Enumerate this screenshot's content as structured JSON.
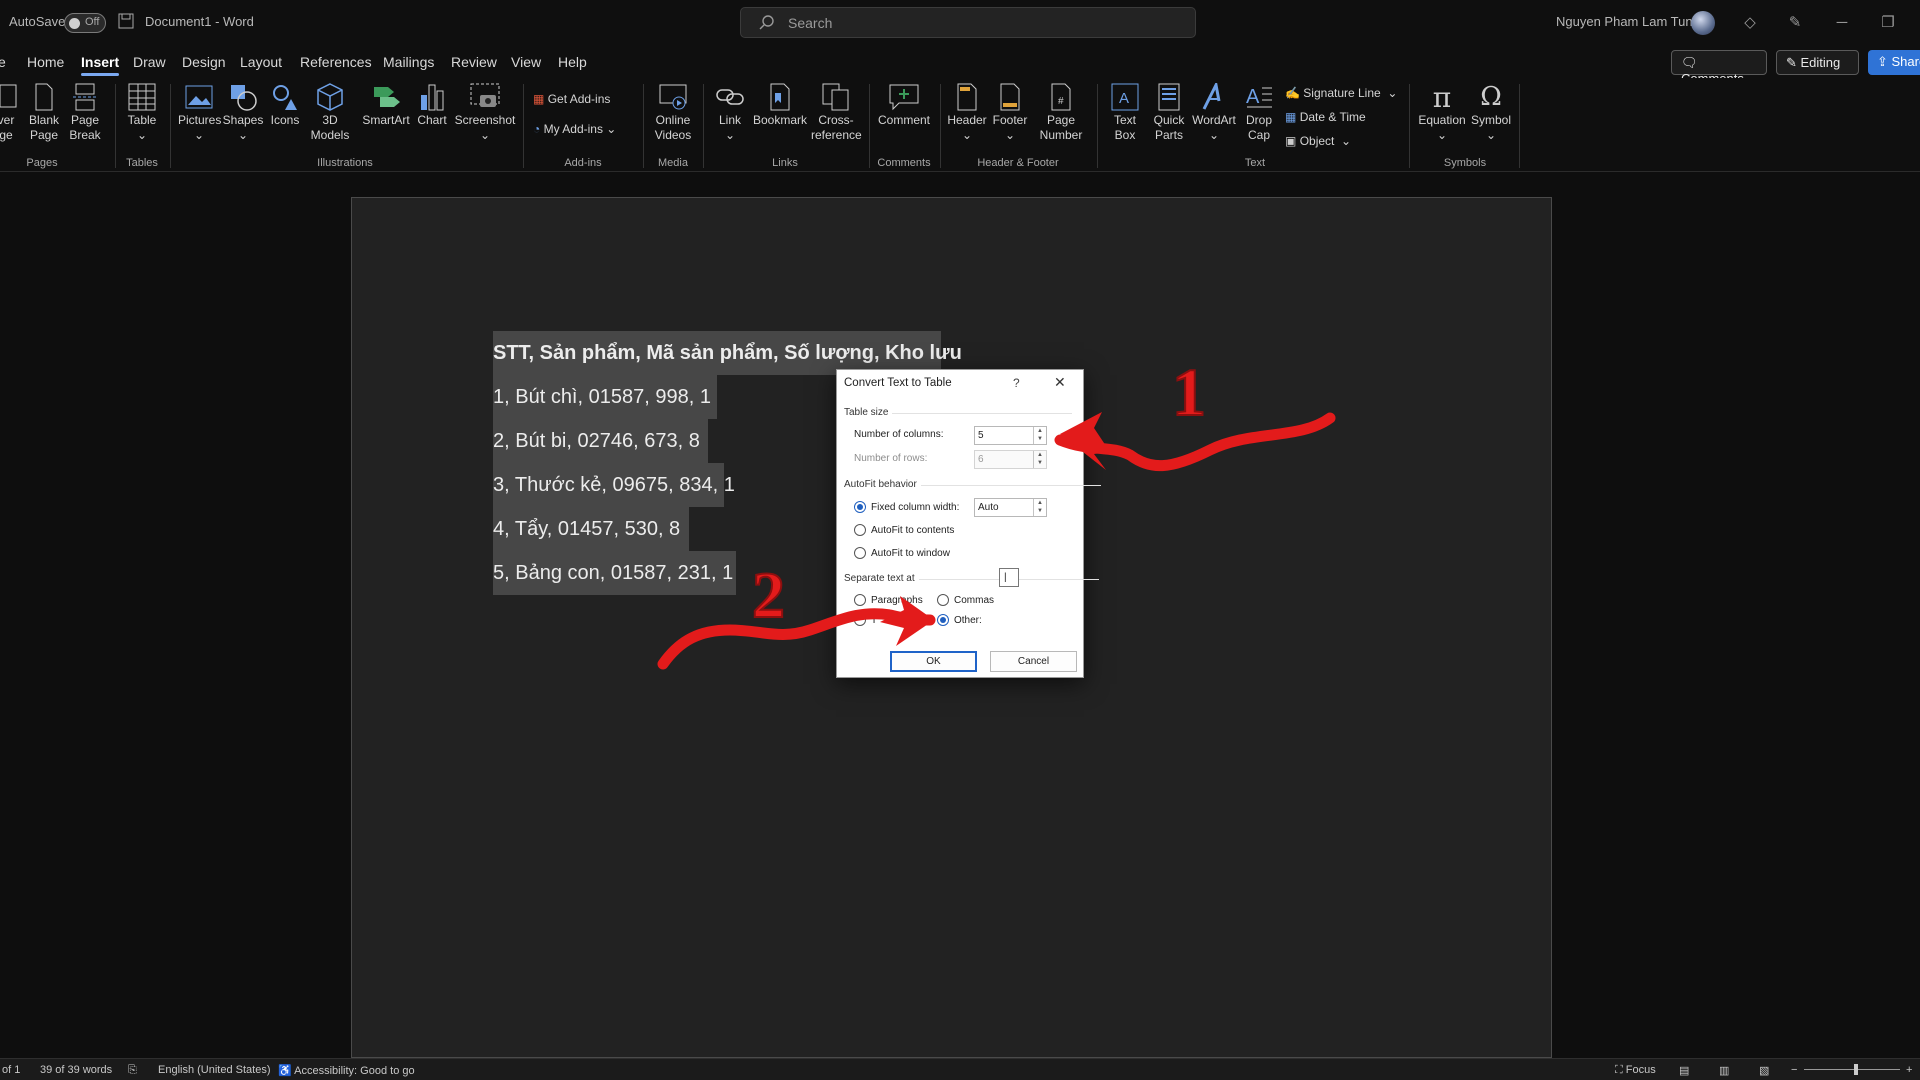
{
  "titlebar": {
    "autosave": "AutoSave",
    "toggle": "Off",
    "doc_title": "Document1 - Word",
    "search_placeholder": "Search",
    "user": "Nguyen Pham Lam Tung"
  },
  "menu": {
    "tabs": [
      "e",
      "Home",
      "Insert",
      "Draw",
      "Design",
      "Layout",
      "References",
      "Mailings",
      "Review",
      "View",
      "Help"
    ],
    "active": "Insert",
    "comments": "Comments",
    "editing": "Editing",
    "share": "Share"
  },
  "ribbon": {
    "pages": {
      "cover": [
        "ver",
        "ge"
      ],
      "blank": [
        "Blank",
        "Page"
      ],
      "break": [
        "Page",
        "Break"
      ],
      "group": "Pages"
    },
    "tables": {
      "table": "Table",
      "group": "Tables"
    },
    "illustrations": {
      "pictures": "Pictures",
      "shapes": "Shapes",
      "icons": "Icons",
      "models": [
        "3D",
        "Models"
      ],
      "smartart": "SmartArt",
      "chart": "Chart",
      "screenshot": "Screenshot",
      "group": "Illustrations"
    },
    "addins": {
      "get": "Get Add-ins",
      "my": "My Add-ins",
      "group": "Add-ins"
    },
    "media": {
      "online": [
        "Online",
        "Videos"
      ],
      "group": "Media"
    },
    "links": {
      "link": "Link",
      "bookmark": "Bookmark",
      "cross": [
        "Cross-",
        "reference"
      ],
      "group": "Links"
    },
    "comments": {
      "comment": "Comment",
      "group": "Comments"
    },
    "headerfooter": {
      "header": "Header",
      "footer": "Footer",
      "pagenum": [
        "Page",
        "Number"
      ],
      "group": "Header & Footer"
    },
    "text": {
      "textbox": [
        "Text",
        "Box"
      ],
      "quickparts": [
        "Quick",
        "Parts"
      ],
      "wordart": "WordArt",
      "dropcap": [
        "Drop",
        "Cap"
      ],
      "signature": "Signature Line",
      "datetime": "Date & Time",
      "object": "Object",
      "group": "Text"
    },
    "symbols": {
      "equation": "Equation",
      "symbol": "Symbol",
      "group": "Symbols"
    }
  },
  "document": {
    "lines": [
      "STT, Sản phẩm, Mã sản phẩm, Số lượng, Kho lưu",
      "1, Bút chì, 01587, 998, 1",
      "2, Bút bi, 02746, 673, 8",
      "3, Thước kẻ, 09675, 834, 1",
      "4, Tẩy, 01457, 530, 8",
      "5, Bảng con, 01587, 231, 1"
    ]
  },
  "dialog": {
    "title": "Convert Text to Table",
    "help": "?",
    "close": "✕",
    "table_size": "Table size",
    "num_columns_label": "Number of columns:",
    "num_columns": "5",
    "num_rows_label": "Number of rows:",
    "num_rows": "6",
    "autofit": "AutoFit behavior",
    "fixed": "Fixed column width:",
    "fixed_value": "Auto",
    "autofit_contents": "AutoFit to contents",
    "autofit_window": "AutoFit to window",
    "separate": "Separate text at",
    "paragraphs": "Paragraphs",
    "commas": "Commas",
    "tabs_partial": "T",
    "other": "Other:",
    "other_value": "|",
    "ok": "OK",
    "cancel": "Cancel"
  },
  "annotations": {
    "one": "1",
    "two": "2"
  },
  "status": {
    "page": "of 1",
    "words": "39 of 39 words",
    "language": "English (United States)",
    "accessibility": "Accessibility: Good to go",
    "focus": "Focus"
  }
}
